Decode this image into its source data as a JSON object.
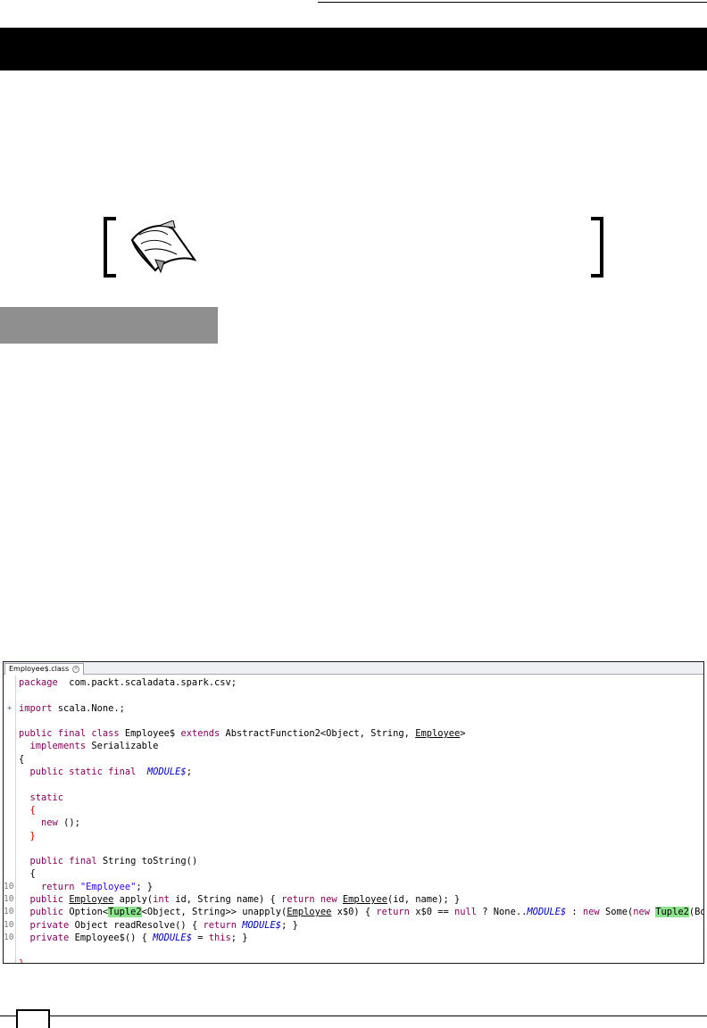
{
  "editor": {
    "tab_label": "Employee$.class",
    "close_glyph": "×"
  },
  "code": [
    {
      "ln": "",
      "fold": "",
      "segs": [
        [
          "kw",
          "package"
        ],
        [
          "",
          "  com.packt.scaladata.spark.csv;"
        ]
      ]
    },
    {
      "ln": "",
      "fold": "",
      "segs": []
    },
    {
      "ln": "",
      "fold": "+",
      "segs": [
        [
          "kw",
          "import"
        ],
        [
          "",
          " scala.None.;"
        ]
      ]
    },
    {
      "ln": "",
      "fold": "",
      "segs": []
    },
    {
      "ln": "",
      "fold": "",
      "segs": [
        [
          "kw",
          "public final class"
        ],
        [
          "",
          " Employee$ "
        ],
        [
          "kw",
          "extends"
        ],
        [
          "",
          " AbstractFunction2<Object, String, "
        ],
        [
          "ul",
          "Employee"
        ],
        [
          "",
          ">"
        ]
      ]
    },
    {
      "ln": "",
      "fold": "",
      "segs": [
        [
          "",
          "  "
        ],
        [
          "kw",
          "implements"
        ],
        [
          "",
          " Serializable"
        ]
      ]
    },
    {
      "ln": "",
      "fold": "",
      "segs": [
        [
          "",
          "{"
        ]
      ]
    },
    {
      "ln": "",
      "fold": "",
      "segs": [
        [
          "",
          "  "
        ],
        [
          "kw",
          "public static final"
        ],
        [
          "",
          "  "
        ],
        [
          "fld",
          "MODULE$"
        ],
        [
          "",
          ";"
        ]
      ]
    },
    {
      "ln": "",
      "fold": "",
      "segs": []
    },
    {
      "ln": "",
      "fold": "",
      "segs": [
        [
          "",
          "  "
        ],
        [
          "kw",
          "static"
        ]
      ]
    },
    {
      "ln": "",
      "fold": "",
      "segs": [
        [
          "",
          "  "
        ],
        [
          "red",
          "{"
        ]
      ]
    },
    {
      "ln": "",
      "fold": "",
      "segs": [
        [
          "",
          "    "
        ],
        [
          "kw",
          "new"
        ],
        [
          "",
          " ();"
        ]
      ]
    },
    {
      "ln": "",
      "fold": "",
      "segs": [
        [
          "",
          "  "
        ],
        [
          "red",
          "}"
        ]
      ]
    },
    {
      "ln": "",
      "fold": "",
      "segs": []
    },
    {
      "ln": "",
      "fold": "",
      "segs": [
        [
          "",
          "  "
        ],
        [
          "kw",
          "public final"
        ],
        [
          "",
          " String toString()"
        ]
      ]
    },
    {
      "ln": "",
      "fold": "",
      "segs": [
        [
          "",
          "  {"
        ]
      ]
    },
    {
      "ln": "10",
      "fold": "",
      "segs": [
        [
          "",
          "    "
        ],
        [
          "kw",
          "return"
        ],
        [
          "",
          " "
        ],
        [
          "str",
          "\"Employee\""
        ],
        [
          "",
          "; }"
        ]
      ]
    },
    {
      "ln": "10",
      "fold": "",
      "segs": [
        [
          "",
          "  "
        ],
        [
          "kw",
          "public"
        ],
        [
          "",
          " "
        ],
        [
          "ul",
          "Employee"
        ],
        [
          "",
          " apply("
        ],
        [
          "kw",
          "int"
        ],
        [
          "",
          " id, String name) { "
        ],
        [
          "kw",
          "return new"
        ],
        [
          "",
          " "
        ],
        [
          "ul",
          "Employee"
        ],
        [
          "",
          "(id, name); }"
        ]
      ]
    },
    {
      "ln": "10",
      "fold": "",
      "segs": [
        [
          "",
          "  "
        ],
        [
          "kw",
          "public"
        ],
        [
          "",
          " Option<"
        ],
        [
          "hl",
          "Tuple2"
        ],
        [
          "",
          "<Object, String>> unapply("
        ],
        [
          "ul",
          "Employee"
        ],
        [
          "",
          " x$0) { "
        ],
        [
          "kw",
          "return"
        ],
        [
          "",
          " x$0 == "
        ],
        [
          "kw",
          "null"
        ],
        [
          "",
          " ? None.."
        ],
        [
          "fld",
          "MODULE$"
        ],
        [
          "",
          " : "
        ],
        [
          "kw",
          "new"
        ],
        [
          "",
          " Some("
        ],
        [
          "kw",
          "new"
        ],
        [
          "",
          " "
        ],
        [
          "hl",
          "Tuple2"
        ],
        [
          "",
          "(BoxesR"
        ]
      ]
    },
    {
      "ln": "10",
      "fold": "",
      "segs": [
        [
          "",
          "  "
        ],
        [
          "kw",
          "private"
        ],
        [
          "",
          " Object readResolve() { "
        ],
        [
          "kw",
          "return"
        ],
        [
          "",
          " "
        ],
        [
          "fld",
          "MODULE$"
        ],
        [
          "",
          "; }"
        ]
      ]
    },
    {
      "ln": "10",
      "fold": "",
      "segs": [
        [
          "",
          "  "
        ],
        [
          "kw",
          "private"
        ],
        [
          "",
          " Employee$() { "
        ],
        [
          "fld",
          "MODULE$"
        ],
        [
          "",
          " = "
        ],
        [
          "kw",
          "this"
        ],
        [
          "",
          "; }"
        ]
      ]
    },
    {
      "ln": "",
      "fold": "",
      "segs": []
    },
    {
      "ln": "",
      "fold": "",
      "segs": [
        [
          "red",
          "}"
        ]
      ]
    }
  ]
}
